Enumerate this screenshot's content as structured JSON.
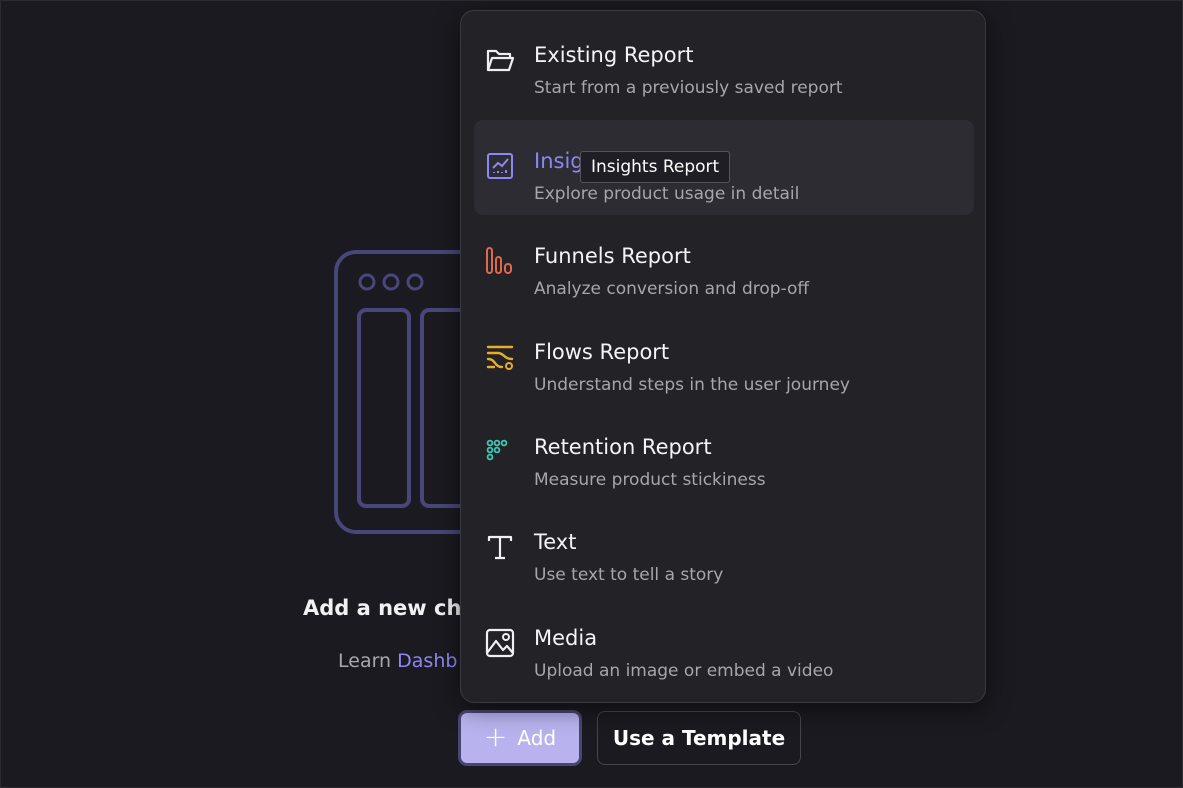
{
  "empty_state": {
    "title": "Add a new ch",
    "learn_prefix": "Learn ",
    "learn_link": "Dashb"
  },
  "actions": {
    "add_label": "Add",
    "template_label": "Use a Template"
  },
  "menu": {
    "items": [
      {
        "title": "Existing Report",
        "subtitle": "Start from a previously saved report",
        "icon": "folder-open-icon"
      },
      {
        "title": "Insights Report",
        "subtitle": "Explore product usage in detail",
        "icon": "insights-chart-icon",
        "color": "#8e86f5"
      },
      {
        "title": "Funnels Report",
        "subtitle": "Analyze conversion and drop-off",
        "icon": "funnel-bars-icon",
        "color": "#e0694d"
      },
      {
        "title": "Flows Report",
        "subtitle": "Understand steps in the user journey",
        "icon": "flows-icon",
        "color": "#e6ad2a"
      },
      {
        "title": "Retention Report",
        "subtitle": "Measure product stickiness",
        "icon": "retention-dots-icon",
        "color": "#3fc7b4"
      },
      {
        "title": "Text",
        "subtitle": "Use text to tell a story",
        "icon": "text-t-icon"
      },
      {
        "title": "Media",
        "subtitle": "Upload an image or embed a video",
        "icon": "image-media-icon"
      }
    ]
  },
  "tooltip": {
    "text": "Insights Report"
  },
  "colors": {
    "background": "#1b1a20",
    "accent": "#8e86f5",
    "add_button": "#b8b3ee"
  }
}
